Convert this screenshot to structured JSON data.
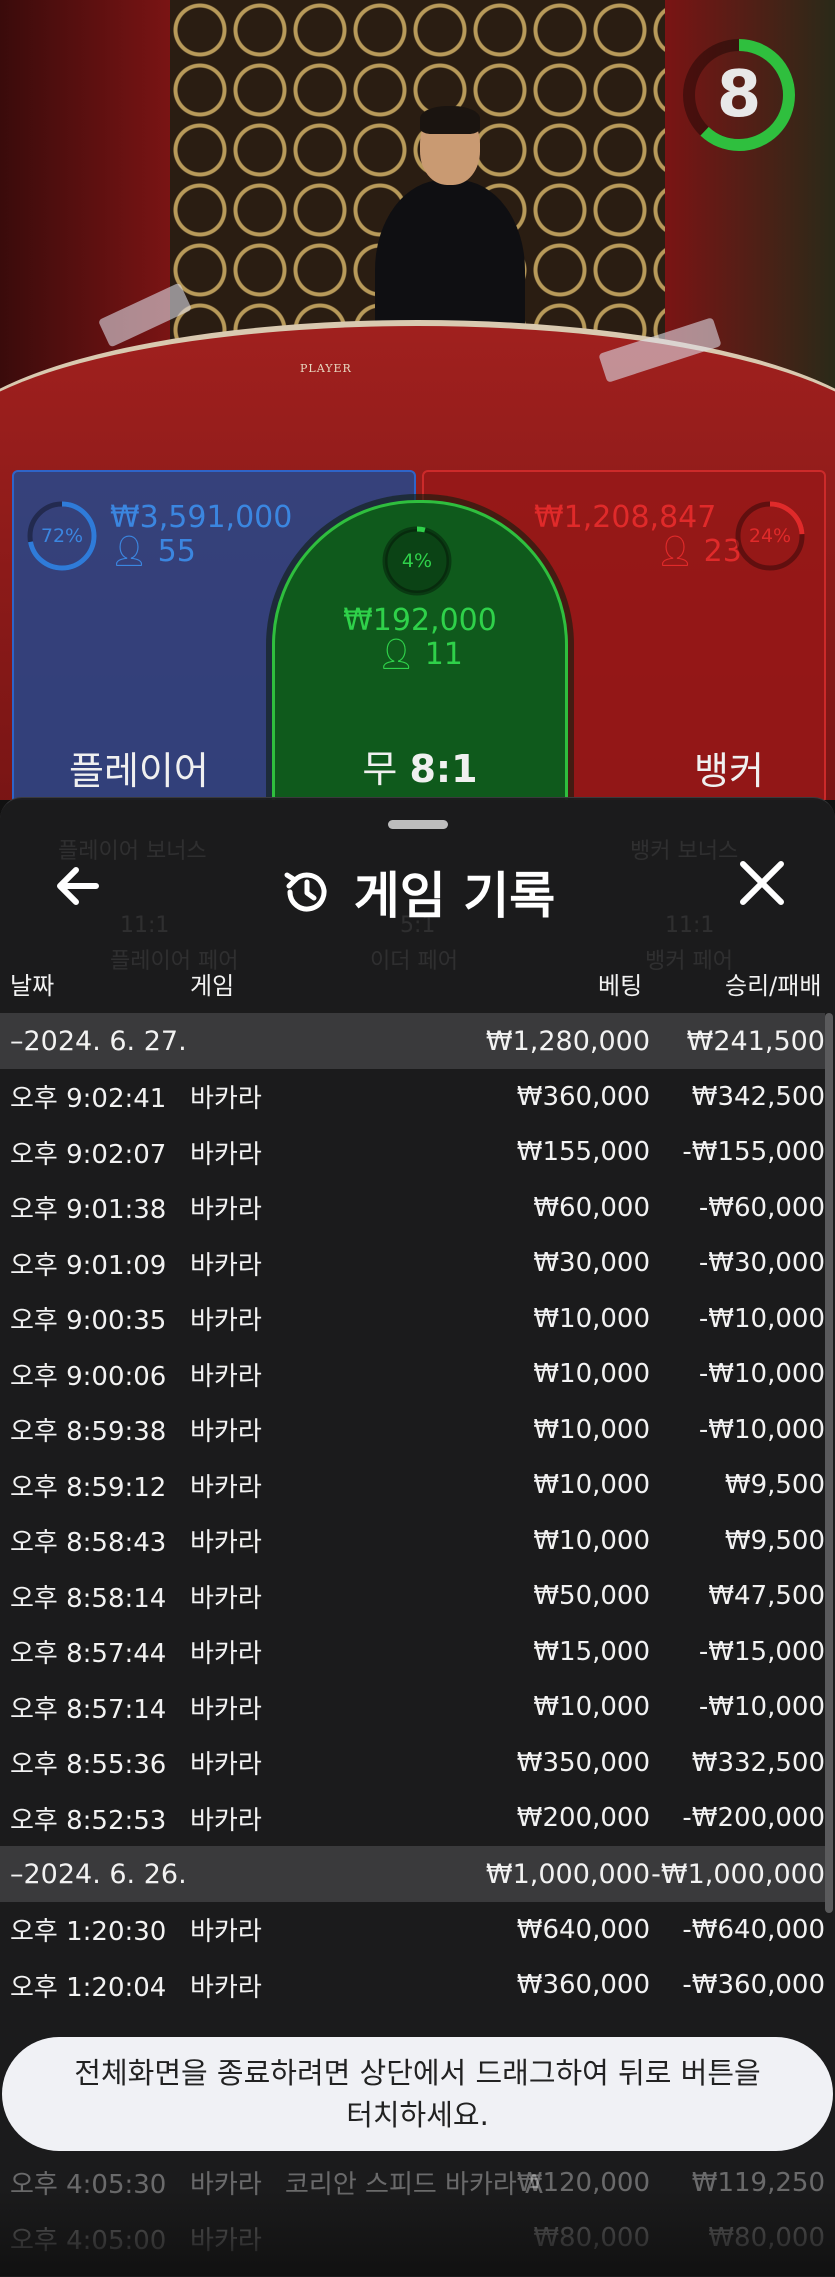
{
  "video": {
    "timer_value": "8",
    "timer_fraction": 0.62,
    "table_mark": "PLAYER"
  },
  "bets": {
    "player": {
      "label": "플레이어",
      "percent": "72%",
      "percent_value": 0.72,
      "amount": "₩3,591,000",
      "count": "55",
      "color": "#2f7bd9"
    },
    "tie": {
      "label": "무",
      "odds": "8:1",
      "percent": "4%",
      "percent_value": 0.04,
      "amount": "₩192,000",
      "count": "11",
      "color": "#2fd14a"
    },
    "banker": {
      "label": "뱅커",
      "percent": "24%",
      "percent_value": 0.24,
      "amount": "₩1,208,847",
      "count": "23",
      "color": "#e02a2a"
    }
  },
  "ghost": {
    "player_bonus": "플레이어 보너스",
    "banker_bonus": "뱅커 보너스",
    "player_pair_odds": "11:1",
    "player_pair": "플레이어 페어",
    "either_pair_odds": "5:1",
    "either_pair": "이더 페어",
    "banker_pair_odds": "11:1",
    "banker_pair": "뱅커 페어"
  },
  "history": {
    "title": "게임 기록",
    "columns": {
      "date": "날짜",
      "game": "게임",
      "bet": "베팅",
      "result": "승리/패배"
    },
    "groups": [
      {
        "date": "–2024. 6. 27.",
        "bet_total": "₩1,280,000",
        "result_total": "₩241,500",
        "rows": [
          {
            "time": "오후 9:02:41",
            "game": "바카라",
            "bet": "₩360,000",
            "result": "₩342,500"
          },
          {
            "time": "오후 9:02:07",
            "game": "바카라",
            "bet": "₩155,000",
            "result": "-₩155,000"
          },
          {
            "time": "오후 9:01:38",
            "game": "바카라",
            "bet": "₩60,000",
            "result": "-₩60,000"
          },
          {
            "time": "오후 9:01:09",
            "game": "바카라",
            "bet": "₩30,000",
            "result": "-₩30,000"
          },
          {
            "time": "오후 9:00:35",
            "game": "바카라",
            "bet": "₩10,000",
            "result": "-₩10,000"
          },
          {
            "time": "오후 9:00:06",
            "game": "바카라",
            "bet": "₩10,000",
            "result": "-₩10,000"
          },
          {
            "time": "오후 8:59:38",
            "game": "바카라",
            "bet": "₩10,000",
            "result": "-₩10,000"
          },
          {
            "time": "오후 8:59:12",
            "game": "바카라",
            "bet": "₩10,000",
            "result": "₩9,500"
          },
          {
            "time": "오후 8:58:43",
            "game": "바카라",
            "bet": "₩10,000",
            "result": "₩9,500"
          },
          {
            "time": "오후 8:58:14",
            "game": "바카라",
            "bet": "₩50,000",
            "result": "₩47,500"
          },
          {
            "time": "오후 8:57:44",
            "game": "바카라",
            "bet": "₩15,000",
            "result": "-₩15,000"
          },
          {
            "time": "오후 8:57:14",
            "game": "바카라",
            "bet": "₩10,000",
            "result": "-₩10,000"
          },
          {
            "time": "오후 8:55:36",
            "game": "바카라",
            "bet": "₩350,000",
            "result": "₩332,500"
          },
          {
            "time": "오후 8:52:53",
            "game": "바카라",
            "bet": "₩200,000",
            "result": "-₩200,000"
          }
        ]
      },
      {
        "date": "–2024. 6. 26.",
        "bet_total": "₩1,000,000",
        "result_total": "-₩1,000,000",
        "rows": [
          {
            "time": "오후 1:20:30",
            "game": "바카라",
            "bet": "₩640,000",
            "result": "-₩640,000"
          },
          {
            "time": "오후 1:20:04",
            "game": "바카라",
            "bet": "₩360,000",
            "result": "-₩360,000"
          }
        ]
      }
    ],
    "partial_rows": [
      {
        "time": "오후 4:05:30",
        "game": "바카라",
        "extra": "코리안 스피드 바카라 A",
        "bet": "₩120,000",
        "result": "₩119,250"
      },
      {
        "time": "오후 4:05:00",
        "game": "바카라",
        "extra": "",
        "bet": "₩80,000",
        "result": "₩80,000"
      }
    ]
  },
  "toast": {
    "message": "전체화면을 종료하려면 상단에서 드래그하여 뒤로 버튼을 터치하세요."
  }
}
